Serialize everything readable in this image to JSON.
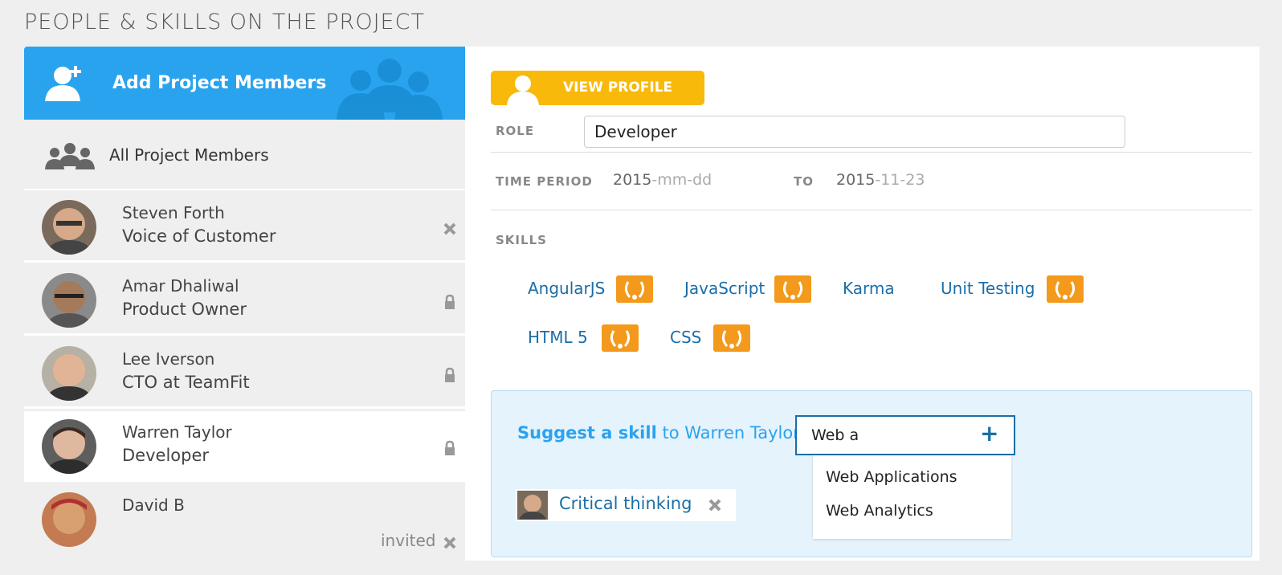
{
  "page_title": "PEOPLE & SKILLS ON THE PROJECT",
  "sidebar": {
    "add_label": "Add Project Members",
    "all_label": "All Project Members",
    "members": [
      {
        "name": "Steven Forth",
        "role": "Voice of Customer",
        "action": "remove"
      },
      {
        "name": "Amar Dhaliwal",
        "role": "Product Owner",
        "action": "lock"
      },
      {
        "name": "Lee Iverson",
        "role": "CTO at TeamFit",
        "action": "lock"
      },
      {
        "name": "Warren Taylor",
        "role": "Developer",
        "action": "lock",
        "selected": true
      },
      {
        "name": "David B",
        "role": "",
        "status": "invited",
        "action": "remove"
      }
    ]
  },
  "main": {
    "view_profile_label": "VIEW PROFILE",
    "role_label": "ROLE",
    "role_value": "Developer",
    "time_period_label": "TIME PERIOD",
    "start_year": "2015",
    "start_rest": "-mm-dd",
    "to_label": "TO",
    "end_year": "2015",
    "end_rest": "-11-23",
    "skills_label": "SKILLS",
    "skills": [
      {
        "name": "AngularJS",
        "endorsed": true
      },
      {
        "name": "JavaScript",
        "endorsed": true
      },
      {
        "name": "Karma",
        "endorsed": false
      },
      {
        "name": "Unit Testing",
        "endorsed": true
      },
      {
        "name": "HTML 5",
        "endorsed": true
      },
      {
        "name": "CSS",
        "endorsed": true
      }
    ],
    "suggest": {
      "bold": "Suggest a skill",
      "rest": " to Warren Taylor",
      "input_value": "Web a",
      "options": [
        "Web Applications",
        "Web Analytics"
      ],
      "suggested_skill": "Critical thinking"
    }
  },
  "colors": {
    "primary_blue": "#2aa3ef",
    "link_blue": "#1a6ea8",
    "yellow": "#f9b90b",
    "badge_orange": "#f39a1d"
  }
}
